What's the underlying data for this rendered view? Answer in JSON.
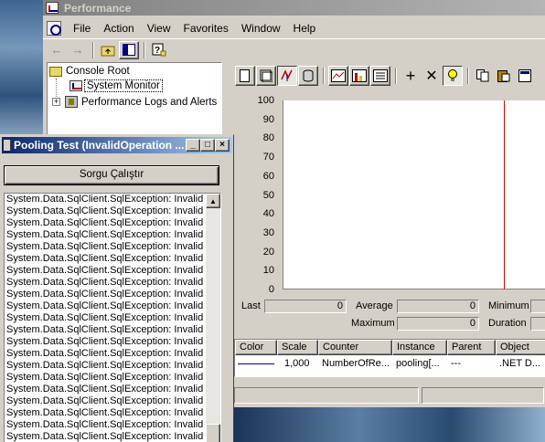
{
  "perf_window": {
    "title": "Performance",
    "menu": [
      "File",
      "Action",
      "View",
      "Favorites",
      "Window",
      "Help"
    ],
    "toolbar_icons": [
      "back-icon",
      "forward-icon",
      "up-folder-icon",
      "show-tree-icon",
      "help-icon"
    ]
  },
  "tree": {
    "root": "Console Root",
    "items": [
      "System Monitor",
      "Performance Logs and Alerts"
    ],
    "expander": "+"
  },
  "sysmon": {
    "toolbar_icons": [
      "new-counter-set-icon",
      "clear-display-icon",
      "view-current-activity-icon",
      "view-log-data-icon",
      "view-graph-icon",
      "view-histogram-icon",
      "view-report-icon",
      "add-icon",
      "delete-icon",
      "highlight-icon",
      "copy-properties-icon",
      "paste-counter-list-icon",
      "properties-icon"
    ],
    "y_axis": [
      "100",
      "90",
      "80",
      "70",
      "60",
      "50",
      "40",
      "30",
      "20",
      "10",
      "0"
    ],
    "line_color": "#e00000",
    "stats": {
      "last_label": "Last",
      "last_value": "0",
      "average_label": "Average",
      "average_value": "0",
      "minimum_label": "Minimum",
      "maximum_label": "Maximum",
      "maximum_value": "0",
      "duration_label": "Duration"
    },
    "table": {
      "headers": [
        "Color",
        "Scale",
        "Counter",
        "Instance",
        "Parent",
        "Object"
      ],
      "rows": [
        {
          "color": "#0000c0",
          "scale": "1,000",
          "counter": "NumberOfRe...",
          "instance": "pooling[...",
          "parent": "---",
          "object": ".NET D..."
        }
      ]
    }
  },
  "pool_window": {
    "title": "Pooling Test (InvalidOperation ...",
    "button": "Sorgu Çalıştır",
    "caption_buttons": {
      "minimize": "_",
      "maximize": "□",
      "close": "×"
    },
    "list_items": [
      "System.Data.SqlClient.SqlException: Invalid ol",
      "System.Data.SqlClient.SqlException: Invalid ol",
      "System.Data.SqlClient.SqlException: Invalid ol",
      "System.Data.SqlClient.SqlException: Invalid ol",
      "System.Data.SqlClient.SqlException: Invalid ol",
      "System.Data.SqlClient.SqlException: Invalid ol",
      "System.Data.SqlClient.SqlException: Invalid ol",
      "System.Data.SqlClient.SqlException: Invalid ol",
      "System.Data.SqlClient.SqlException: Invalid ol",
      "System.Data.SqlClient.SqlException: Invalid ol",
      "System.Data.SqlClient.SqlException: Invalid ol",
      "System.Data.SqlClient.SqlException: Invalid ol",
      "System.Data.SqlClient.SqlException: Invalid ol",
      "System.Data.SqlClient.SqlException: Invalid ol",
      "System.Data.SqlClient.SqlException: Invalid ol",
      "System.Data.SqlClient.SqlException: Invalid ol",
      "System.Data.SqlClient.SqlException: Invalid ol",
      "System.Data.SqlClient.SqlException: Invalid ol",
      "System.Data.SqlClient.SqlException: Invalid ol",
      "System.Data.SqlClient.SqlException: Invalid ol",
      "System.Data.SqlClient.SqlException: Invalid ol"
    ]
  }
}
